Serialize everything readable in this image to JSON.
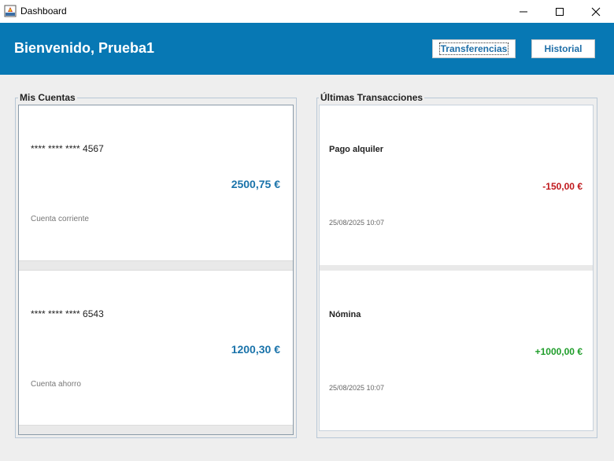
{
  "window": {
    "title": "Dashboard",
    "icons": [
      "app-icon",
      "minimize-icon",
      "maximize-icon",
      "close-icon"
    ]
  },
  "header": {
    "welcome": "Bienvenido, Prueba1",
    "transfer_label": "Transferencias",
    "history_label": "Historial",
    "background_color": "#0778b4"
  },
  "accounts": {
    "title": "Mis Cuentas",
    "items": [
      {
        "number": "**** **** **** 4567",
        "balance": "2500,75 €",
        "type": "Cuenta corriente"
      },
      {
        "number": "**** **** **** 6543",
        "balance": "1200,30 €",
        "type": "Cuenta ahorro"
      }
    ]
  },
  "transactions": {
    "title": "Últimas Transacciones",
    "items": [
      {
        "description": "Pago alquiler",
        "amount": "-150,00 €",
        "date": "25/08/2025 10:07",
        "amount_color": "#c0181c"
      },
      {
        "description": "Nómina",
        "amount": "+1000,00 €",
        "date": "25/08/2025 10:07",
        "amount_color": "#1f9d2a"
      }
    ]
  }
}
